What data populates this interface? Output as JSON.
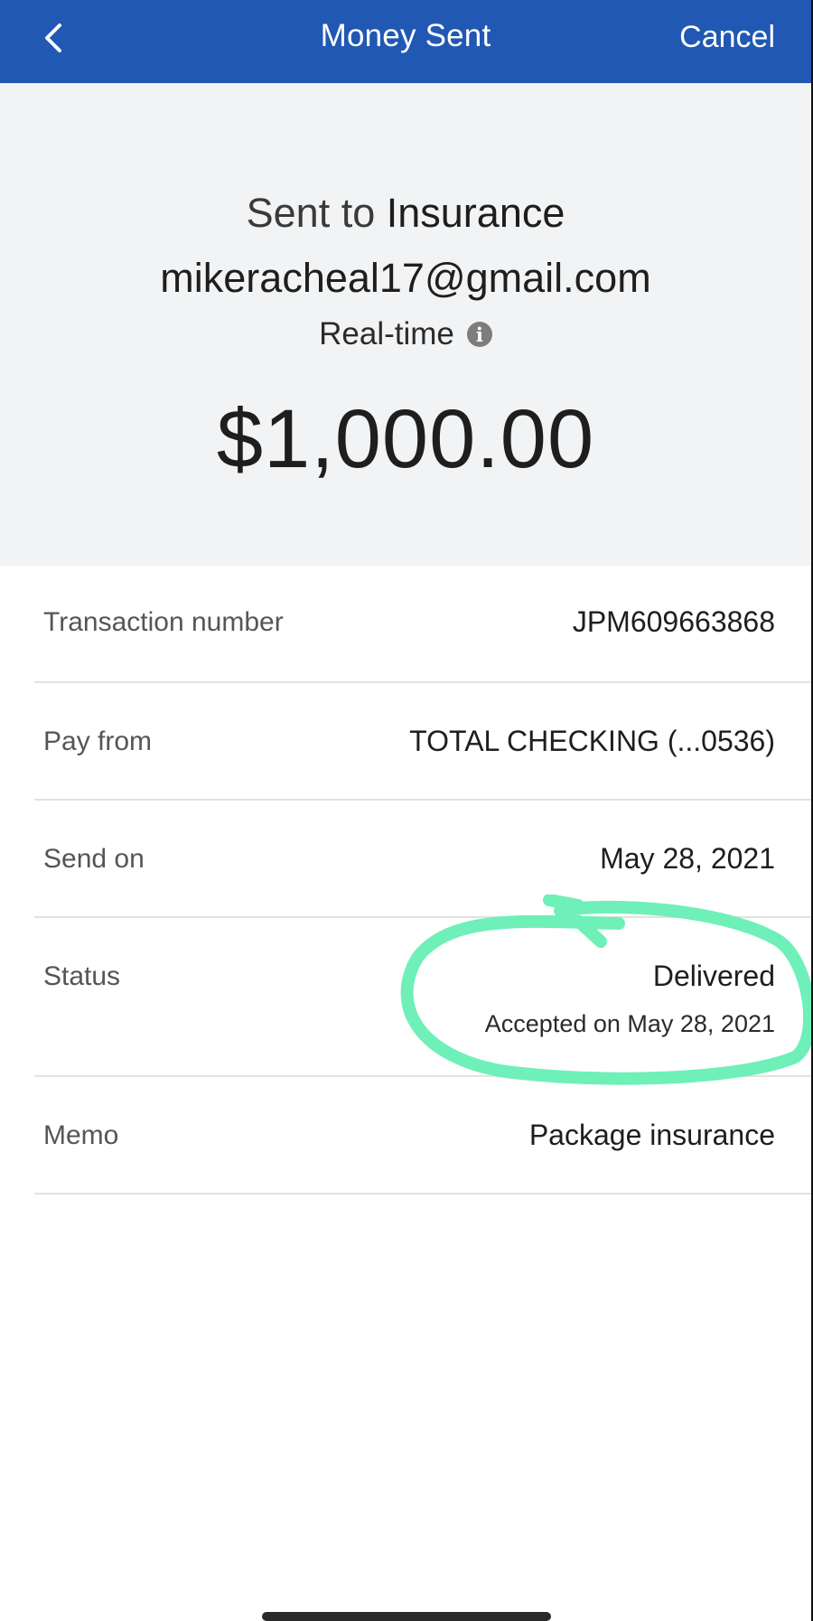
{
  "header": {
    "title": "Money Sent",
    "cancel_label": "Cancel",
    "back_icon": "chevron-left-icon",
    "background": "#2158b3"
  },
  "summary": {
    "sent_prefix": "Sent to",
    "recipient_name": "Insurance",
    "recipient_email": "mikeracheal17@gmail.com",
    "speed_label": "Real-time",
    "speed_icon": "info-icon",
    "amount": "$1,000.00"
  },
  "details": {
    "transaction_number": {
      "label": "Transaction number",
      "value": "JPM609663868"
    },
    "pay_from": {
      "label": "Pay from",
      "value": "TOTAL CHECKING (...0536)"
    },
    "send_on": {
      "label": "Send on",
      "value": "May 28, 2021"
    },
    "status": {
      "label": "Status",
      "value": "Delivered",
      "sub_value": "Accepted on May 28, 2021"
    },
    "memo": {
      "label": "Memo",
      "value": "Package insurance"
    }
  },
  "annotation": {
    "color": "#6ef0b8"
  }
}
